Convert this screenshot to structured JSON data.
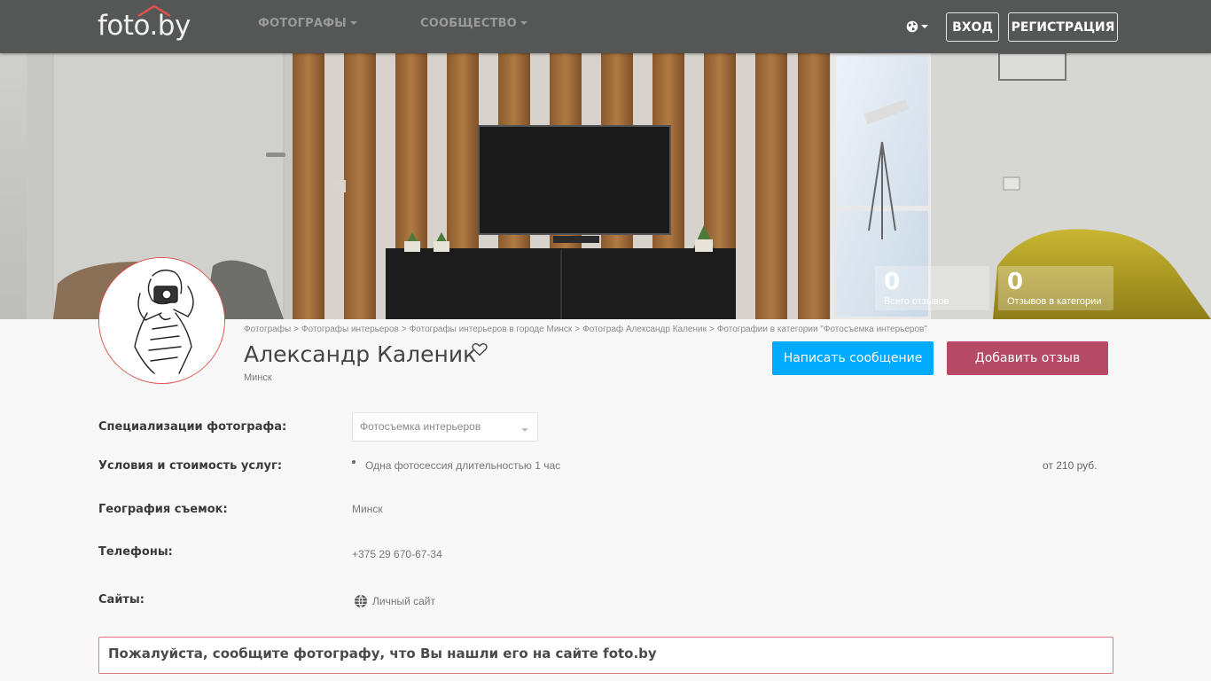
{
  "header": {
    "logo": "foto.by",
    "nav": [
      {
        "label": "ФОТОГРАФЫ"
      },
      {
        "label": "СООБЩЕСТВО"
      }
    ],
    "login_label": "ВХОД",
    "register_label": "РЕГИСТРАЦИЯ"
  },
  "stats": [
    {
      "value": "0",
      "label": "Всего отзывов"
    },
    {
      "value": "0",
      "label": "Отзывов в категории"
    }
  ],
  "breadcrumb": [
    "Фотографы",
    "Фотографы интерьеров",
    "Фотографы интерьеров в городе Минск",
    "Фотограф Александр Каленик",
    "Фотографии в категории \"Фотосъемка интерьеров\""
  ],
  "profile": {
    "name": "Александр Каленик",
    "city": "Минск",
    "message_button": "Написать сообщение",
    "review_button": "Добавить отзыв"
  },
  "details": {
    "specializations_label": "Специализации фотографа:",
    "specializations_value": "Фотосъемка интерьеров",
    "services_label": "Условия и стоимость услуг:",
    "service_item": "Одна фотосессия длительностью 1 час",
    "service_price": "от 210 руб.",
    "geography_label": "География съемок:",
    "geography_value": "Минск",
    "phones_label": "Телефоны:",
    "phone_value": "+375 29 670-67-34",
    "sites_label": "Сайты:",
    "site_value": "Личный сайт"
  },
  "notice": "Пожалуйста, сообщите фотографу, что Вы нашли его на сайте foto.by",
  "colors": {
    "header_bg": "#555656",
    "message_button": "#00aaff",
    "review_button": "#b54a66",
    "notice_border": "#e07b7b"
  }
}
